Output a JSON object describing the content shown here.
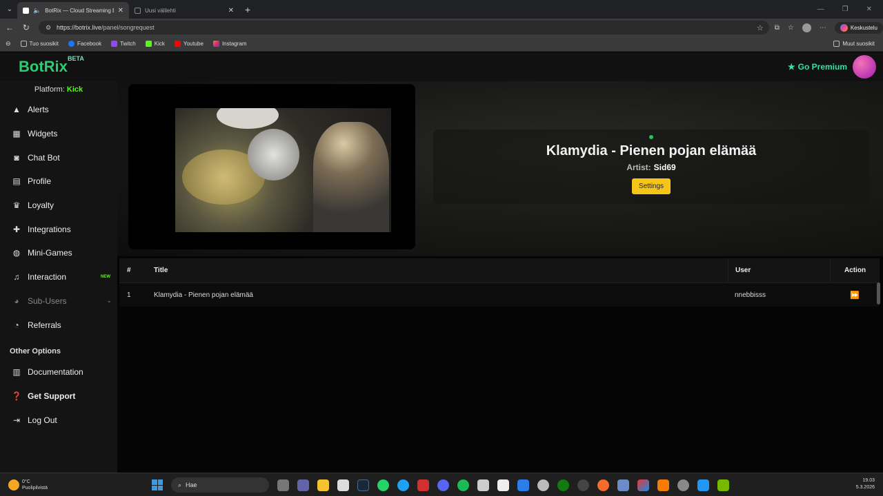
{
  "browser": {
    "tabs": [
      {
        "title": "BotRix — Cloud Streaming Bo",
        "active": true
      },
      {
        "title": "Uusi välilehti",
        "active": false
      }
    ],
    "url_host": "https://botrix.live",
    "url_path": "/panel/songrequest",
    "copilot_label": "Keskustelu",
    "bookmarks": {
      "import": "Tuo suosikit",
      "facebook": "Facebook",
      "twitch": "Twitch",
      "kick": "Kick",
      "youtube": "Youtube",
      "instagram": "Instagram",
      "other": "Muut suosikit"
    }
  },
  "header": {
    "logo": "BotRix",
    "logo_badge": "BETA",
    "premium_label": "Go Premium"
  },
  "sidebar": {
    "platform_label": "Platform:",
    "platform_value": "Kick",
    "items": [
      {
        "label": "Alerts",
        "icon": "warning-icon"
      },
      {
        "label": "Widgets",
        "icon": "grid-icon"
      },
      {
        "label": "Chat Bot",
        "icon": "robot-icon"
      },
      {
        "label": "Profile",
        "icon": "id-card-icon"
      },
      {
        "label": "Loyalty",
        "icon": "trophy-icon"
      },
      {
        "label": "Integrations",
        "icon": "puzzle-icon"
      },
      {
        "label": "Mini-Games",
        "icon": "gamepad-icon"
      },
      {
        "label": "Interaction",
        "icon": "music-icon",
        "badge": "NEW"
      },
      {
        "label": "Sub-Users",
        "icon": "users-icon"
      },
      {
        "label": "Referrals",
        "icon": "user-friends-icon"
      }
    ],
    "other_options_title": "Other Options",
    "other_items": [
      {
        "label": "Documentation",
        "icon": "book-icon"
      },
      {
        "label": "Get Support",
        "icon": "question-icon"
      },
      {
        "label": "Log Out",
        "icon": "logout-icon"
      }
    ]
  },
  "now_playing": {
    "title": "Klamydia - Pienen pojan elämää",
    "artist_label": "Artist:",
    "artist": "Sid69",
    "settings_label": "Settings"
  },
  "queue": {
    "columns": {
      "num": "#",
      "title": "Title",
      "user": "User",
      "action": "Action"
    },
    "rows": [
      {
        "num": "1",
        "title": "Klamydia - Pienen pojan elämää",
        "user": "nnebbisss"
      }
    ]
  },
  "taskbar": {
    "temp": "0°C",
    "weather": "Puolipilvistä",
    "search_placeholder": "Hae",
    "time": "19.03",
    "date": "5.3.2026"
  },
  "colors": {
    "brand_green": "#2ecc71",
    "kick_green": "#53fc18",
    "premium_teal": "#2ee6a8",
    "settings_yellow": "#f5c518"
  }
}
